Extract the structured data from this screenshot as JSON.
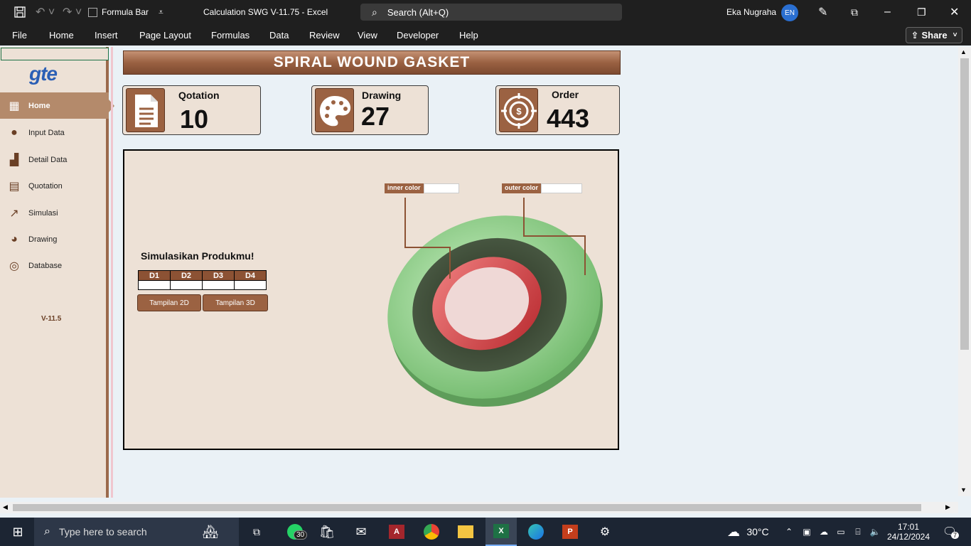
{
  "titlebar": {
    "formula_bar_label": "Formula Bar",
    "doc_title": "Calculation SWG V-11.75  -  Excel",
    "search_placeholder": "Search (Alt+Q)",
    "user_name": "Eka Nugraha",
    "user_initials": "EN"
  },
  "menu": [
    "File",
    "Home",
    "Insert",
    "Page Layout",
    "Formulas",
    "Data",
    "Review",
    "View",
    "Developer",
    "Help"
  ],
  "share_label": "Share",
  "sidebar": {
    "logo": "gte",
    "items": [
      {
        "label": "Home",
        "icon": "dashboard-icon",
        "active": true
      },
      {
        "label": "Input Data",
        "icon": "money-bag-icon"
      },
      {
        "label": "Detail Data",
        "icon": "bar-chart-icon"
      },
      {
        "label": "Quotation",
        "icon": "document-icon"
      },
      {
        "label": "Simulasi",
        "icon": "trend-icon"
      },
      {
        "label": "Drawing",
        "icon": "palette-icon"
      },
      {
        "label": "Database",
        "icon": "target-icon"
      }
    ],
    "version": "V-11.5"
  },
  "banner": "SPIRAL WOUND GASKET",
  "cards": {
    "quotation": {
      "label": "Qotation",
      "value": "10"
    },
    "drawing": {
      "label": "Drawing",
      "value": "27"
    },
    "order": {
      "label": "Order",
      "value": "443"
    }
  },
  "simulation": {
    "title": "Simulasikan Produkmu!",
    "columns": [
      "D1",
      "D2",
      "D3",
      "D4"
    ],
    "btn_2d": "Tampilan 2D",
    "btn_3d": "Tampilan 3D",
    "inner_label": "inner color",
    "outer_label": "outer color",
    "colors": {
      "outer_ring": "#8fd18a",
      "winding": "#3c4a3a",
      "inner_ring": "#d9474c",
      "center": "#efd8d6"
    }
  },
  "taskbar": {
    "search_placeholder": "Type here to search",
    "whatsapp_badge": "30",
    "weather": "30°C",
    "time": "17:01",
    "date": "24/12/2024",
    "notification_count": "7"
  }
}
